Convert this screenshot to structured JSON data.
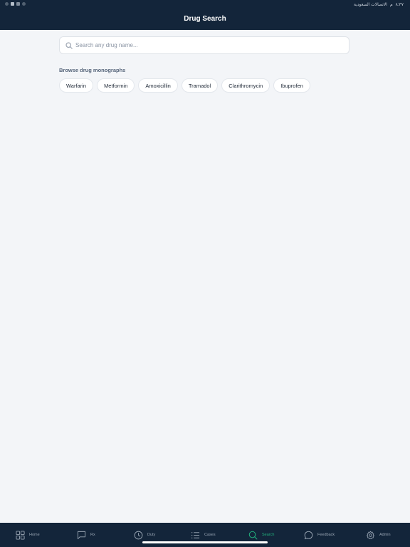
{
  "status_bar": {
    "time": "٨:٣٧",
    "period": "م",
    "carrier": "الاتصالات السعودية"
  },
  "header": {
    "title": "Drug Search"
  },
  "search": {
    "placeholder": "Search any drug name...",
    "value": ""
  },
  "browse": {
    "label": "Browse drug monographs",
    "chips": [
      "Warfarin",
      "Metformin",
      "Amoxicillin",
      "Tramadol",
      "Clarithromycin",
      "Ibuprofen"
    ]
  },
  "tabs": [
    {
      "label": "Home",
      "icon": "grid-icon",
      "active": false
    },
    {
      "label": "Rx",
      "icon": "message-square-icon",
      "active": false
    },
    {
      "label": "Duty",
      "icon": "clock-icon",
      "active": false
    },
    {
      "label": "Cases",
      "icon": "list-icon",
      "active": false
    },
    {
      "label": "Search",
      "icon": "search-icon",
      "active": true
    },
    {
      "label": "Feedback",
      "icon": "chat-bubble-icon",
      "active": false
    },
    {
      "label": "Admin",
      "icon": "gear-icon",
      "active": false
    }
  ],
  "colors": {
    "header_bg": "#13253a",
    "page_bg": "#f3f5f8",
    "accent": "#22b07d"
  }
}
